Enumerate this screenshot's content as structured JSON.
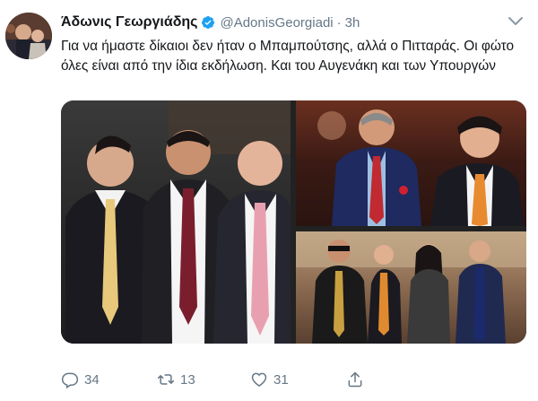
{
  "tweet": {
    "author_name": "Άδωνις Γεωργιάδης",
    "handle": "@AdonisGeorgiadi",
    "separator": "·",
    "time": "3h",
    "text": "Για να ήμαστε δίκαιοι δεν ήταν ο Μπαμπούτσης, αλλά ο Πιτταράς. Οι φώτο όλες είναι από την ίδια εκδήλωση. Και του Αυγενάκη και των Υπουργών",
    "counts": {
      "replies": "34",
      "retweets": "13",
      "likes": "31"
    }
  },
  "icons": {
    "verified": "verified-badge-icon",
    "menu": "chevron-down-icon",
    "reply": "reply-icon",
    "retweet": "retweet-icon",
    "like": "heart-icon",
    "share": "share-icon"
  },
  "colors": {
    "verified": "#1da1f2",
    "muted": "#657786",
    "text": "#14171a"
  }
}
